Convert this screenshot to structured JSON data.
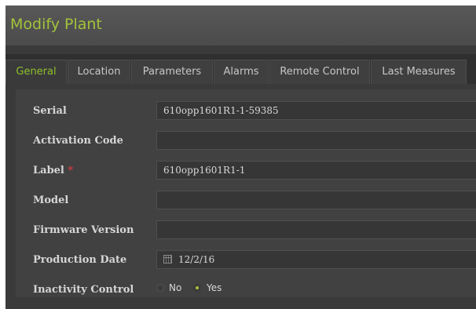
{
  "window": {
    "title": "Modify Plant"
  },
  "tabs": [
    {
      "label": "General",
      "active": true
    },
    {
      "label": "Location"
    },
    {
      "label": "Parameters"
    },
    {
      "label": "Alarms"
    },
    {
      "label": "Remote Control"
    },
    {
      "label": "Last Measures"
    }
  ],
  "form": {
    "serial": {
      "label": "Serial",
      "value": "610opp1601R1-1-59385"
    },
    "activation_code": {
      "label": "Activation Code",
      "value": ""
    },
    "plant_label": {
      "label": "Label",
      "required_mark": "*",
      "value": "610opp1601R1-1"
    },
    "model": {
      "label": "Model",
      "value": ""
    },
    "firmware_version": {
      "label": "Firmware Version",
      "value": ""
    },
    "production_date": {
      "label": "Production Date",
      "value": "12/2/16",
      "icon": "calendar-icon"
    },
    "inactivity_control": {
      "label": "Inactivity Control",
      "options": [
        "No",
        "Yes"
      ],
      "selected": "Yes"
    }
  },
  "colors": {
    "accent": "#a3c33b",
    "active_tab": "#8fbf2c",
    "required": "#d13a3a"
  }
}
